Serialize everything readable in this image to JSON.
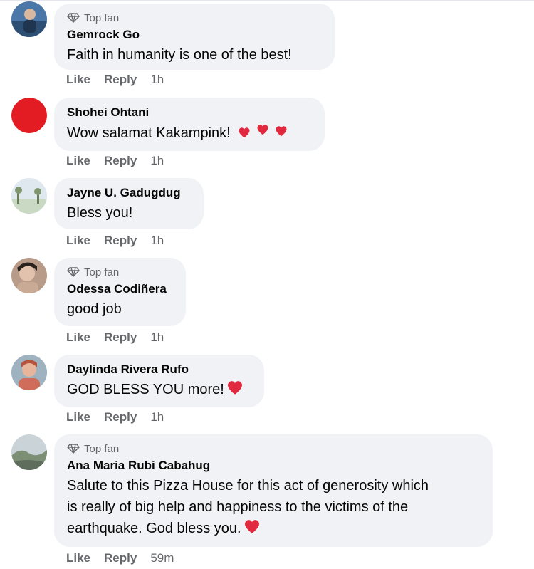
{
  "colors": {
    "bubble": "#f0f2f5",
    "meta": "#65676b",
    "text": "#050505",
    "heart": "#e0283f",
    "red_avatar": "#e31b23"
  },
  "top_fan_label": "Top fan",
  "comments": [
    {
      "author": "Gemrock Go",
      "text": "Faith in humanity is one of the best!",
      "top_fan": true,
      "like": "Like",
      "reply": "Reply",
      "time": "1h",
      "avatar_icon": "person-photo-avatar"
    },
    {
      "author": "Shohei Ohtani",
      "text": "Wow salamat Kakampink!",
      "top_fan": false,
      "like": "Like",
      "reply": "Reply",
      "time": "1h",
      "avatar_icon": "red-circle-avatar",
      "emoji": "three-hearts"
    },
    {
      "author": "Jayne U. Gadugdug",
      "text": "Bless you!",
      "top_fan": false,
      "like": "Like",
      "reply": "Reply",
      "time": "1h",
      "avatar_icon": "beach-photo-avatar"
    },
    {
      "author": "Odessa Codiñera",
      "text": "good job",
      "top_fan": true,
      "like": "Like",
      "reply": "Reply",
      "time": "1h",
      "avatar_icon": "person-photo-avatar"
    },
    {
      "author": "Daylinda Rivera Rufo",
      "text": "GOD BLESS YOU more!",
      "top_fan": false,
      "like": "Like",
      "reply": "Reply",
      "time": "1h",
      "avatar_icon": "person-photo-avatar",
      "emoji": "red-heart"
    },
    {
      "author": "Ana Maria Rubi Cabahug",
      "text_lines": [
        "Salute to this Pizza House for this act of generosity which",
        "is really of big help and happiness to the victims of the",
        "earthquake. God bless you."
      ],
      "top_fan": true,
      "like": "Like",
      "reply": "Reply",
      "time": "59m",
      "avatar_icon": "landscape-photo-avatar",
      "emoji": "red-heart"
    }
  ]
}
